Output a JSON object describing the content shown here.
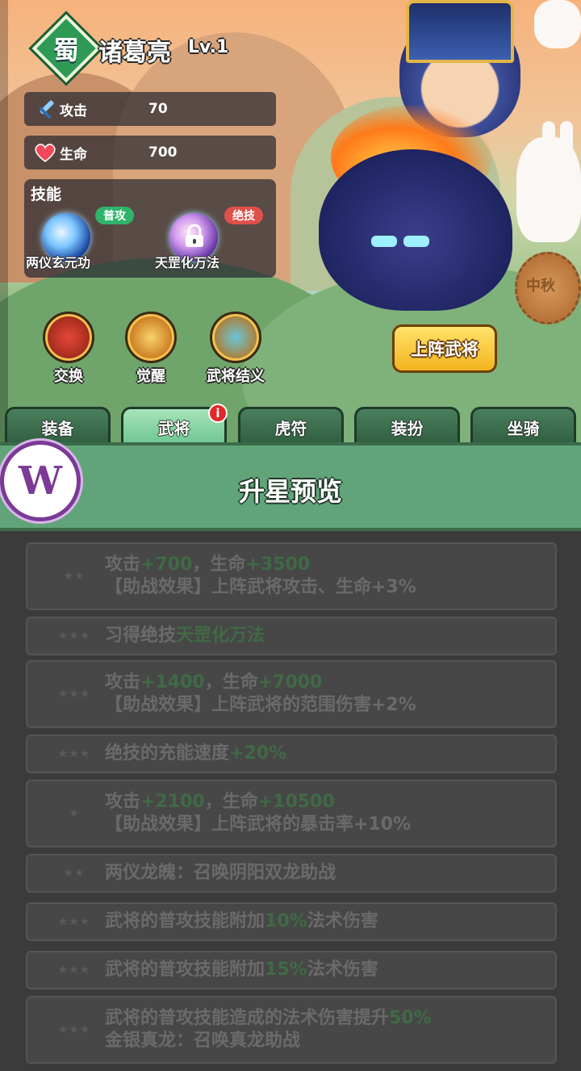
{
  "hero": {
    "faction": "蜀",
    "name": "诸葛亮",
    "level": "Lv.1"
  },
  "stats": {
    "attack_label": "攻击",
    "attack_value": "70",
    "hp_label": "生命",
    "hp_value": "700"
  },
  "skills": {
    "title": "技能",
    "normal_tag": "普攻",
    "ult_tag": "绝技",
    "normal_name": "两仪玄元功",
    "ult_name": "天罡化万法"
  },
  "actions": {
    "swap": "交换",
    "awaken": "觉醒",
    "bond": "武将结义"
  },
  "deploy_button": "上阵武将",
  "mooncake_text": "中秋",
  "tabs": [
    "装备",
    "武将",
    "虎符",
    "装扮",
    "坐骑"
  ],
  "tab_badge": "i",
  "modal": {
    "title": "升星预览",
    "rows": [
      {
        "stars": "★★",
        "line1": [
          "攻击",
          "+700",
          "，生命",
          "+3500"
        ],
        "line2": "【助战效果】上阵武将攻击、生命+3%"
      },
      {
        "stars": "★★★",
        "line1": [
          "习得绝技",
          "天罡化万法"
        ]
      },
      {
        "stars": "★★★",
        "line1": [
          "攻击",
          "+1400",
          "，生命",
          "+7000"
        ],
        "line2": "【助战效果】上阵武将的范围伤害+2%"
      },
      {
        "stars": "★★★",
        "line1": [
          "绝技的充能速度",
          "+20%"
        ]
      },
      {
        "stars": "★",
        "line1": [
          "攻击",
          "+2100",
          "，生命",
          "+10500"
        ],
        "line2": "【助战效果】上阵武将的暴击率+10%"
      },
      {
        "stars": "★★",
        "line1": [
          "两仪龙魄：召唤阴阳双龙助战"
        ]
      },
      {
        "stars": "★★★",
        "line1": [
          "武将的普攻技能附加",
          "10%",
          "法术伤害"
        ]
      },
      {
        "stars": "★★★",
        "line1": [
          "武将的普攻技能附加",
          "15%",
          "法术伤害"
        ]
      },
      {
        "stars": "★★★",
        "line1": [
          "武将的普攻技能造成的法术伤害提升",
          "50%"
        ],
        "line2": "金银真龙：召唤真龙助战"
      }
    ]
  },
  "logo_letter": "W",
  "colors": {
    "accent_green": "#62a479",
    "value_green": "#3f6a45",
    "deploy_gold": "#f3b51f"
  }
}
